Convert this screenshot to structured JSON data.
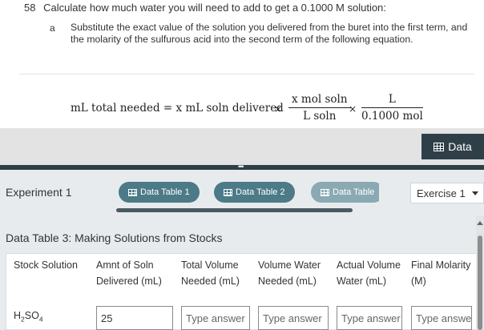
{
  "question": {
    "number": "58",
    "text": "Calculate how much water you will need to add to get a 0.1000 M solution:",
    "sub_letter": "a",
    "sub_text": "Substitute the exact value of the solution you delivered from the buret into the first term, and the molarity of the sulfurous acid into the second term of the following equation."
  },
  "equation": {
    "left": "mL total needed = x mL soln delivered",
    "times": "×",
    "frac1_num": "x mol soln",
    "frac1_den": "L soln",
    "frac2_num": "L",
    "frac2_den": "0.1000 mol"
  },
  "toolbar": {
    "data_button": "Data"
  },
  "panel": {
    "experiment_label": "Experiment 1",
    "tabs": [
      {
        "label": "Data Table 1"
      },
      {
        "label": "Data Table 2"
      },
      {
        "label": "Data Table"
      }
    ],
    "exercise_select": "Exercise 1"
  },
  "table": {
    "title": "Data Table 3: Making Solutions from Stocks",
    "headers": [
      "Stock Solution",
      "Amnt of Soln Delivered (mL)",
      "Total Volume Needed (mL)",
      "Volume Water Needed (mL)",
      "Actual Volume Water (mL)",
      "Final Molarity (M)"
    ],
    "row": {
      "stock": "H",
      "stock_sub1": "2",
      "stock_mid": "SO",
      "stock_sub2": "4",
      "amount_delivered": "25",
      "placeholder": "Type answer"
    }
  },
  "colors": {
    "panel_dark": "#2e3f48",
    "tab_teal": "#4c7a87",
    "panel_bg": "#e8ebed"
  }
}
